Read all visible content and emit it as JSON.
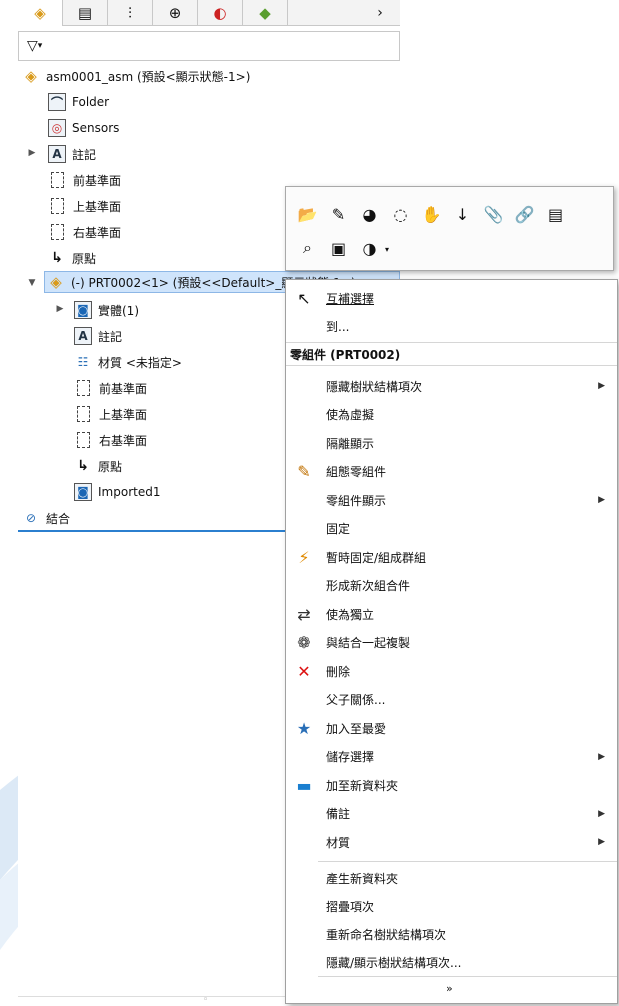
{
  "tabs": [
    {
      "icon": "assembly-tab-icon",
      "glyph": "◈"
    },
    {
      "icon": "property-manager-icon",
      "glyph": "▤"
    },
    {
      "icon": "configuration-icon",
      "glyph": "⫶"
    },
    {
      "icon": "dimxpert-icon",
      "glyph": "⊕"
    },
    {
      "icon": "display-manager-icon",
      "glyph": "◐"
    },
    {
      "icon": "appearance-icon",
      "glyph": "◆"
    }
  ],
  "tabs_more": "›",
  "filter_icon": "▽",
  "tree": {
    "root": "asm0001_asm (預設<顯示狀態-1>)",
    "folder": "Folder",
    "sensors": "Sensors",
    "annotations": "註記",
    "front_plane": "前基準面",
    "top_plane": "上基準面",
    "right_plane": "右基準面",
    "origin": "原點",
    "component": "(-) PRT0002<1> (預設<<Default>_顯示狀態 1>)",
    "solid_bodies": "實體(1)",
    "comp_annotations": "註記",
    "material": "材質 <未指定>",
    "comp_front_plane": "前基準面",
    "comp_top_plane": "上基準面",
    "comp_right_plane": "右基準面",
    "comp_origin": "原點",
    "imported": "Imported1",
    "mates": "結合"
  },
  "toolbar": {
    "row1": [
      {
        "name": "open-part-icon",
        "g": "📂"
      },
      {
        "name": "edit-icon",
        "g": "✎"
      },
      {
        "name": "appearance-icon",
        "g": "◕"
      },
      {
        "name": "hide-icon",
        "g": "◌"
      },
      {
        "name": "isolate-icon",
        "g": "✋"
      },
      {
        "name": "insert-icon",
        "g": "↓"
      },
      {
        "name": "paperclip-icon",
        "g": "📎"
      },
      {
        "name": "paperclip2-icon",
        "g": "🔗"
      },
      {
        "name": "properties-icon",
        "g": "▤"
      }
    ],
    "row2": [
      {
        "name": "zoom-icon",
        "g": "⌕"
      },
      {
        "name": "component-icon",
        "g": "▣"
      },
      {
        "name": "color-icon",
        "g": "◑"
      }
    ]
  },
  "menu": {
    "select_other": "互補選擇",
    "goto": "到...",
    "header": "零組件 (PRT0002)",
    "items": [
      {
        "label": "隱藏樹狀結構項次",
        "icon": "",
        "sub": true
      },
      {
        "label": "使為虛擬",
        "icon": "",
        "sub": false
      },
      {
        "label": "隔離顯示",
        "icon": "",
        "sub": false
      },
      {
        "label": "組態零組件",
        "icon": "configure-icon",
        "sub": false
      },
      {
        "label": "零組件顯示",
        "icon": "",
        "sub": true
      },
      {
        "label": "固定",
        "icon": "",
        "sub": false
      },
      {
        "label": "暫時固定/組成群組",
        "icon": "temp-fix-icon",
        "sub": false
      },
      {
        "label": "形成新次組合件",
        "icon": "",
        "sub": false
      },
      {
        "label": "使為獨立",
        "icon": "make-independent-icon",
        "sub": false
      },
      {
        "label": "與結合一起複製",
        "icon": "copy-with-mates-icon",
        "sub": false
      },
      {
        "label": "刪除",
        "icon": "delete-icon",
        "sub": false
      },
      {
        "label": "父子關係...",
        "icon": "",
        "sub": false
      },
      {
        "label": "加入至最愛",
        "icon": "favorite-icon",
        "sub": false
      },
      {
        "label": "儲存選擇",
        "icon": "",
        "sub": true
      },
      {
        "label": "加至新資料夾",
        "icon": "folder-icon",
        "sub": false
      },
      {
        "label": "備註",
        "icon": "",
        "sub": true
      },
      {
        "label": "材質",
        "icon": "",
        "sub": true
      }
    ],
    "bottom_items": [
      "產生新資料夾",
      "摺疊項次",
      "重新命名樹狀結構項次",
      "隱藏/顯示樹狀結構項次..."
    ],
    "more": "»"
  },
  "colors": {
    "selection": "#cfe4fb",
    "accent": "#2b7fcf"
  }
}
